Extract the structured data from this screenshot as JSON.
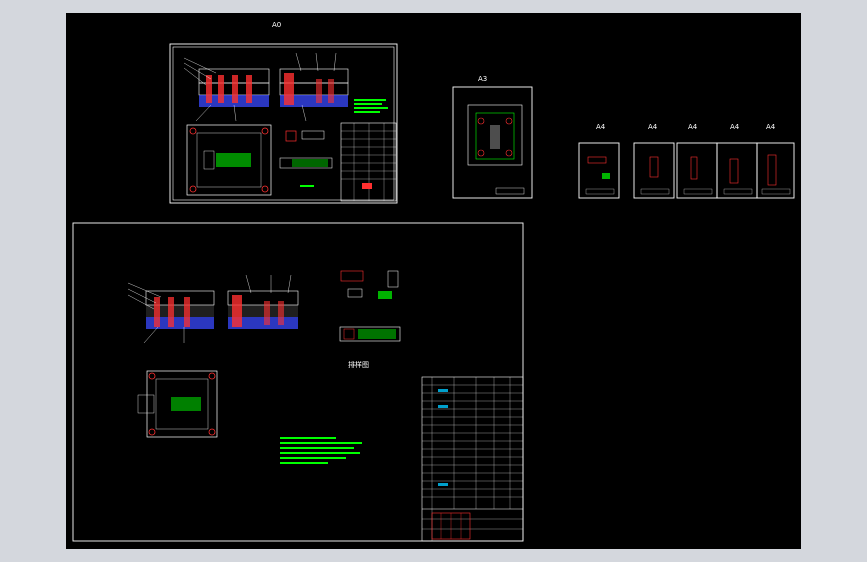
{
  "drawing": {
    "sheet_labels": {
      "assembly_top": "A0",
      "cavity_plate": "A3",
      "part_1": "A4",
      "part_2": "A4",
      "part_3": "A4",
      "part_4": "A4",
      "part_5": "A4"
    },
    "bom_title": "排样图"
  },
  "colors": {
    "background": "#000000",
    "frame": "#d4d7dd",
    "line": "#ffffff",
    "part": "#ff3030",
    "plate": "#3a4aff",
    "annotation": "#00ff00",
    "accent": "#00c8ff"
  }
}
